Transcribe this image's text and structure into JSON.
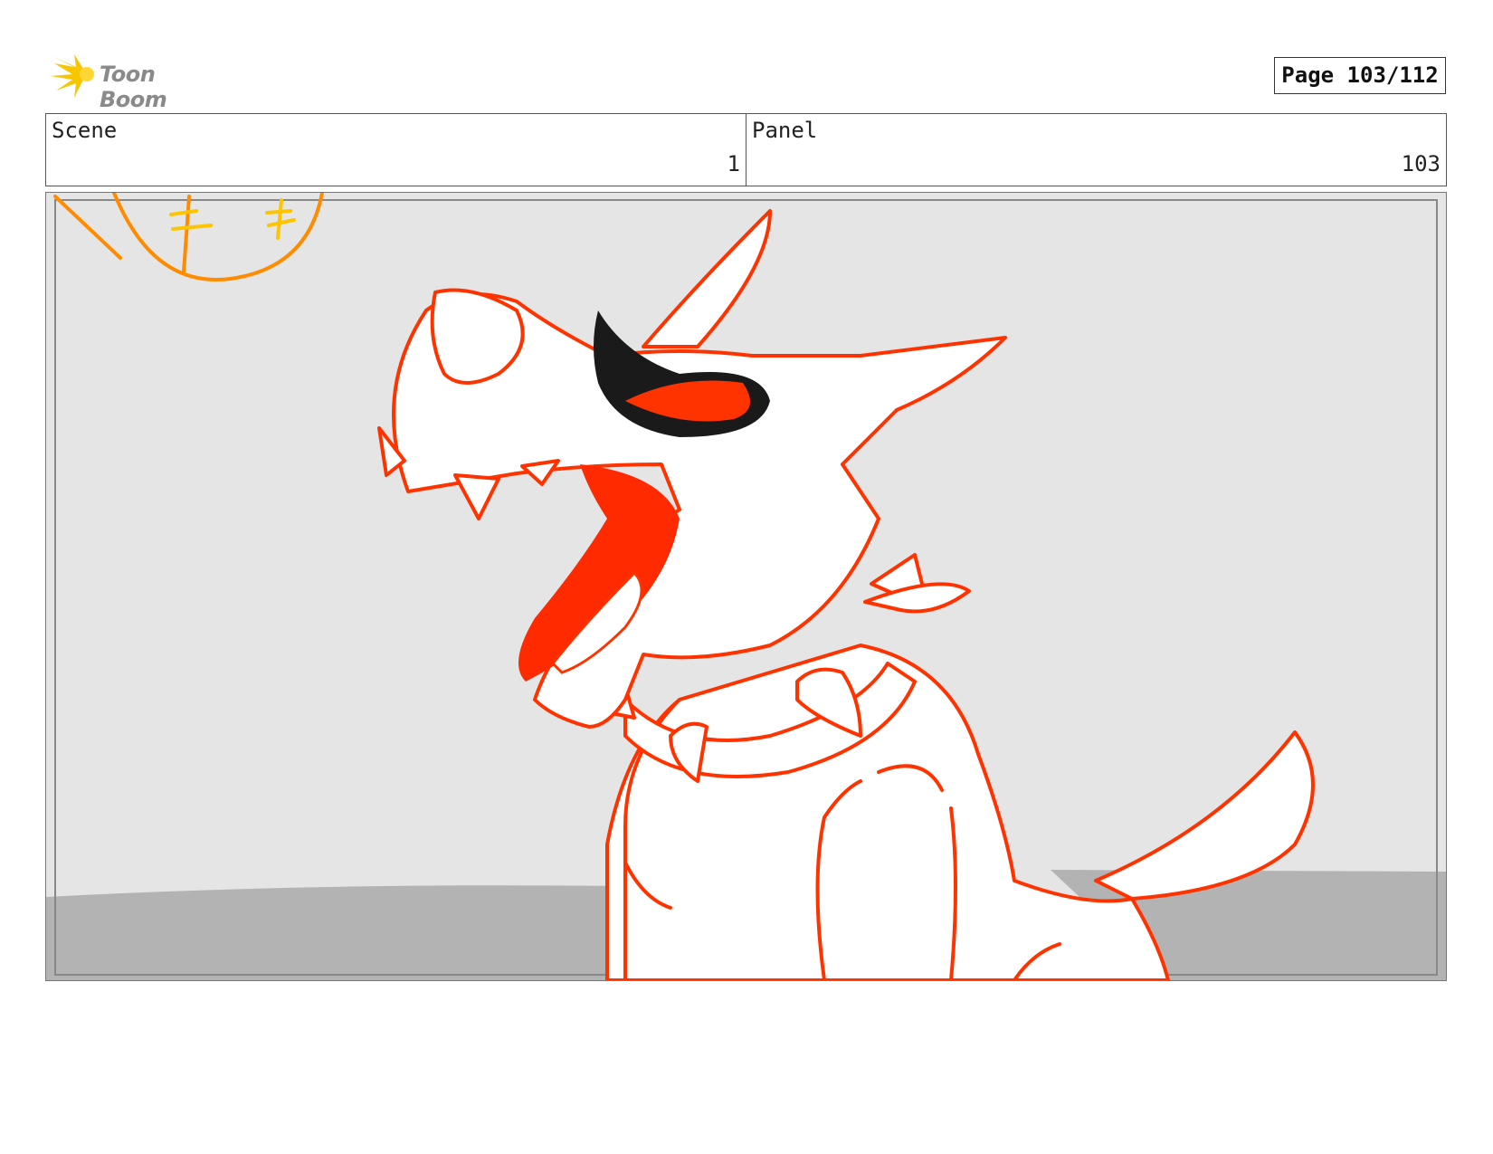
{
  "header": {
    "logo_text": "Toon Boom",
    "page_label": "Page 103/112"
  },
  "scene": {
    "label": "Scene",
    "value": "1"
  },
  "panel": {
    "label": "Panel",
    "value": "103"
  },
  "colors": {
    "sky": "#e5e5e5",
    "ground": "#b3b3b3",
    "line_red": "#ff3300",
    "mouth_red": "#ff2a00",
    "sun_orange": "#ff8c00",
    "sun_yellow": "#ffc400",
    "eye_black": "#1a1a1a"
  },
  "illustration": {
    "subject": "storyboard-drawing",
    "icons": [
      "toon-boom-logo-icon",
      "sun-icon"
    ]
  }
}
